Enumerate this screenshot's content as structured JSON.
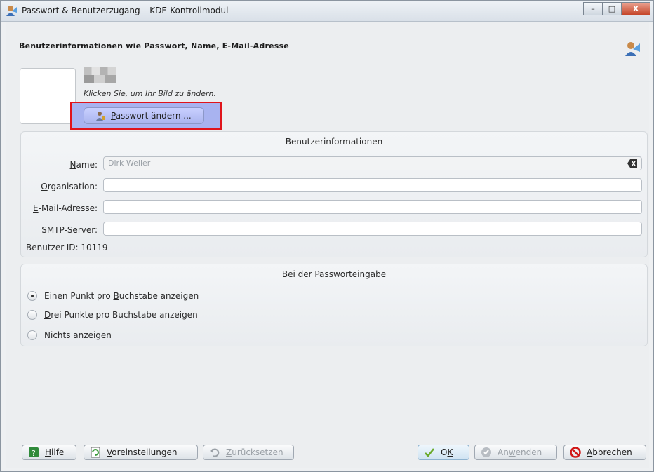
{
  "window": {
    "title": "Passwort & Benutzerzugang – KDE-Kontrollmodul",
    "controls": {
      "minimize": "–",
      "maximize": "□",
      "close": "X"
    }
  },
  "header": {
    "title": "Benutzerinformationen wie Passwort, Name, E-Mail-Adresse"
  },
  "face": {
    "hint": "Klicken Sie, um Ihr Bild zu ändern."
  },
  "password_button": {
    "label_underlined": "P",
    "label_rest": "asswort ändern ..."
  },
  "user_info": {
    "title": "Benutzerinformationen",
    "name": {
      "label_underlined": "N",
      "label_rest": "ame:",
      "value": "Dirk Weller"
    },
    "organisation": {
      "label_underlined": "O",
      "label_rest": "rganisation:",
      "value": ""
    },
    "email": {
      "label_underlined": "E",
      "label_rest": "-Mail-Adresse:",
      "value": ""
    },
    "smtp": {
      "label_underlined": "S",
      "label_rest": "MTP-Server:",
      "value": ""
    },
    "user_id": "Benutzer-ID: 10119"
  },
  "password_entry": {
    "title": "Bei der Passworteingabe",
    "options": [
      {
        "label_pre": "Einen Punkt pro ",
        "label_underlined": "B",
        "label_post": "uchstabe anzeigen",
        "selected": true
      },
      {
        "label_pre": "",
        "label_underlined": "D",
        "label_post": "rei Punkte pro Buchstabe anzeigen",
        "selected": false
      },
      {
        "label_pre": "Ni",
        "label_underlined": "c",
        "label_post": "hts anzeigen",
        "selected": false
      }
    ]
  },
  "buttons": {
    "help": {
      "u": "H",
      "rest": "ilfe"
    },
    "defaults": {
      "u": "V",
      "rest": "oreinstellungen"
    },
    "reset": {
      "u": "Z",
      "rest": "urücksetzen"
    },
    "ok": {
      "pre": "O",
      "u": "K",
      "rest": ""
    },
    "apply": {
      "pre": "An",
      "u": "w",
      "rest": "enden"
    },
    "cancel": {
      "u": "A",
      "rest": "bbrechen"
    }
  },
  "colors": {
    "highlight_border": "#e0141b",
    "selected_button": "#aab4ee"
  }
}
